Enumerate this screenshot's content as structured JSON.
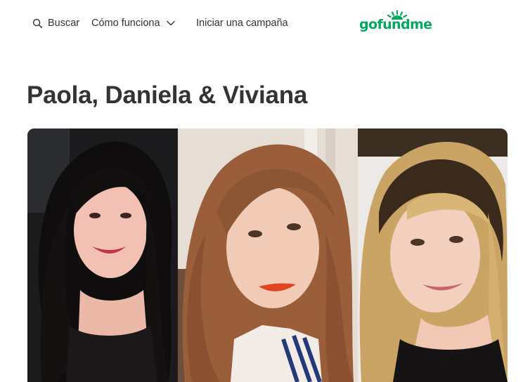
{
  "header": {
    "search_label": "Buscar",
    "how_it_works_label": "Cómo funciona",
    "start_campaign_label": "Iniciar una campaña",
    "logo_text": "gofundme",
    "brand_color": "#02a95c"
  },
  "campaign": {
    "title": "Paola, Daniela & Viviana"
  },
  "icons": {
    "search": "search-icon",
    "dropdown": "chevron-down-icon"
  }
}
